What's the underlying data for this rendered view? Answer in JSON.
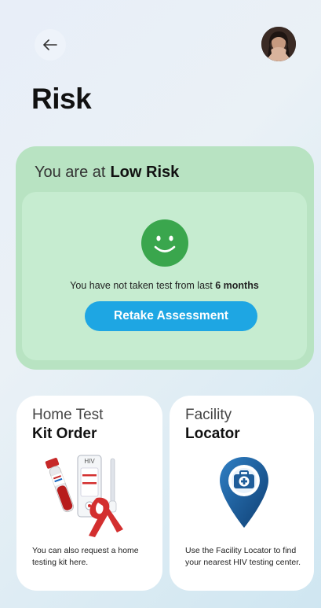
{
  "header": {
    "back_label": "←",
    "title": "Risk"
  },
  "risk": {
    "prefix": "You are at",
    "level": "Low Risk",
    "note_prefix": "You have not taken test from last",
    "note_months": "6 months",
    "button_label": "Retake Assessment"
  },
  "cards": {
    "home_test": {
      "title_line1": "Home Test",
      "title_line2": "Kit Order",
      "kit_label": "HIV",
      "description": "You can also request a home testing kit here."
    },
    "facility": {
      "title_line1": "Facility",
      "title_line2": "Locator",
      "description": "Use the Facility Locator to find your nearest HIV testing center."
    }
  },
  "colors": {
    "accent": "#1ea6e3",
    "risk_card": "#b8e3c2",
    "risk_inner": "#c6ecd0",
    "smiley": "#3aa64d",
    "pin": "#1b5e99"
  },
  "icons": {
    "back": "arrow-left-icon",
    "smiley": "smiley-face-icon",
    "pin": "location-pin-icon"
  }
}
